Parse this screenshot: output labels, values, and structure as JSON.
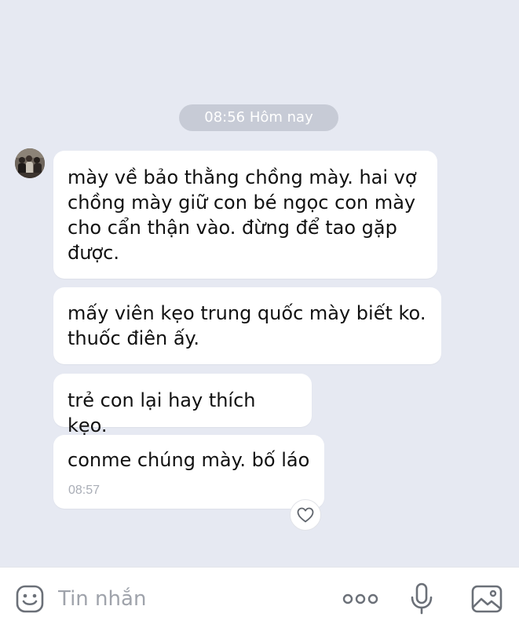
{
  "chat": {
    "time_divider": "08:56 Hôm nay",
    "messages": [
      {
        "text": "mày về bảo thằng chồng mày. hai vợ\nchồng mày giữ con bé ngọc con mày\ncho cẩn thận vào. đừng để tao gặp\nđược."
      },
      {
        "text": "mấy viên kẹo trung quốc mày biết ko.\nthuốc điên ấy."
      },
      {
        "text": "trẻ con lại hay thích kẹo."
      },
      {
        "text": "conme chúng mày. bố láo",
        "time": "08:57"
      }
    ]
  },
  "input_bar": {
    "placeholder": "Tin nhắn",
    "icons": [
      "sticker-icon",
      "more-icon",
      "microphone-icon",
      "image-icon"
    ]
  },
  "colors": {
    "chat_background": "#E6E9F2",
    "bubble": "#FFFFFF",
    "time_pill": "#C7CBD6",
    "icon": "#6B7078"
  }
}
